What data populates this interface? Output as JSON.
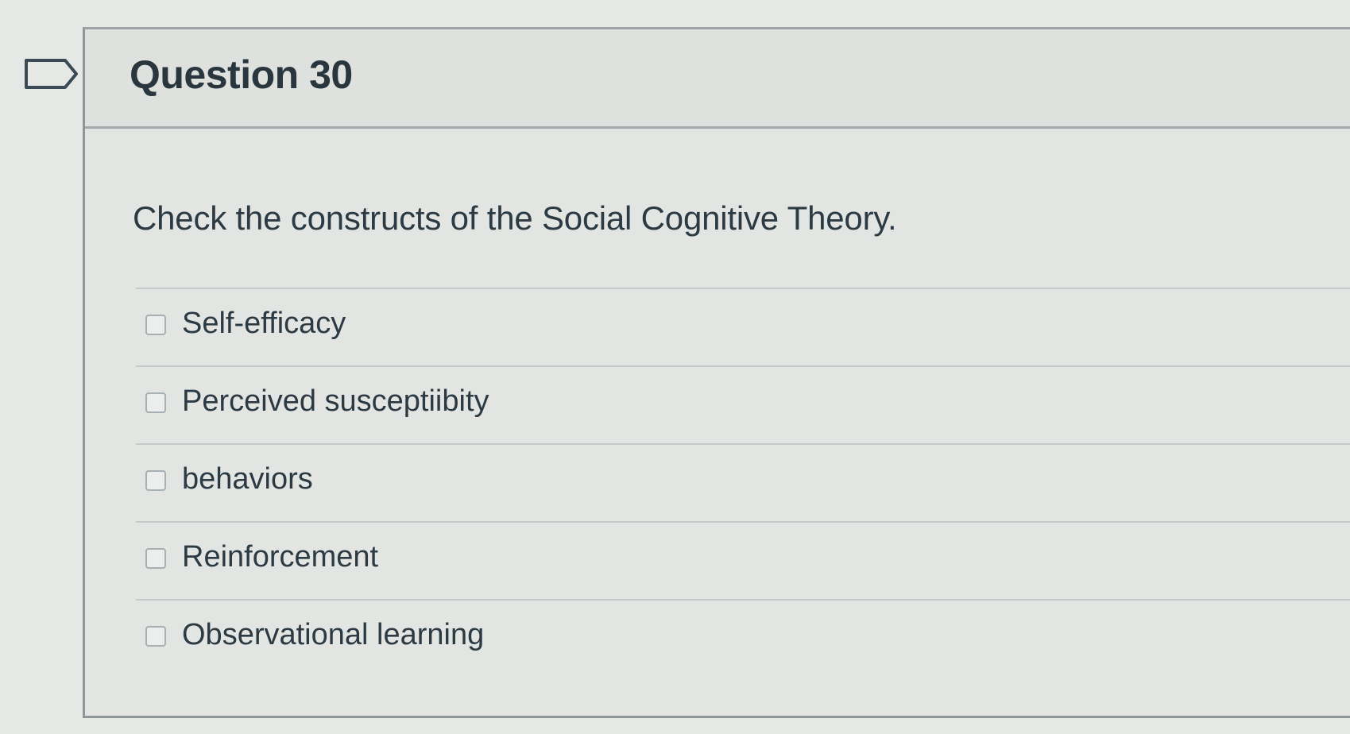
{
  "question": {
    "title": "Question 30",
    "text": "Check the constructs of the Social Cognitive Theory.",
    "answers": [
      {
        "label": "Self-efficacy",
        "checked": false
      },
      {
        "label": "Perceived susceptiibity",
        "checked": false
      },
      {
        "label": "behaviors",
        "checked": false
      },
      {
        "label": "Reinforcement",
        "checked": false
      },
      {
        "label": "Observational learning",
        "checked": false
      }
    ]
  },
  "icons": {
    "flag": "flag-question-icon"
  },
  "colors": {
    "text": "#2d3b45",
    "border": "#a3a8aa",
    "background": "#e6e8e6"
  }
}
